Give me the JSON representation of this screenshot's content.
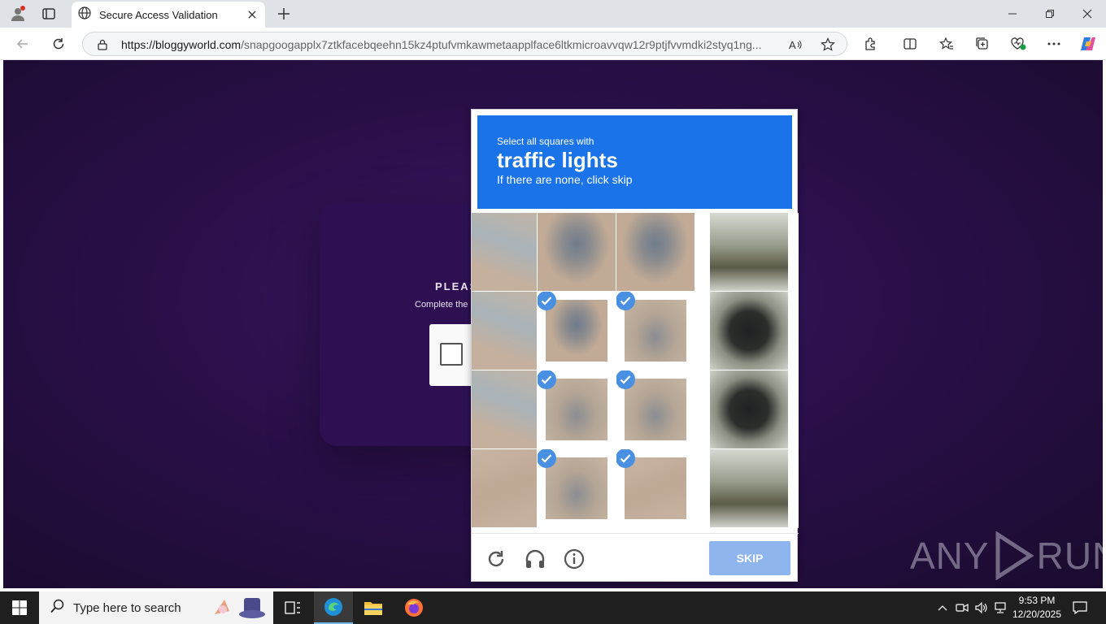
{
  "browser": {
    "tab_title": "Secure Access Validation",
    "url_host": "https://bloggyworld.com",
    "url_path": "/snapgoogapplx7ztkfacebqeehn15kz4ptufvmkawmetaapplface6ltkmicroavvqw12r9ptjfvvmdki2styq1ng..."
  },
  "page": {
    "heading": "PLEAS",
    "subtext": "Complete the"
  },
  "captcha": {
    "line1": "Select all squares with",
    "target": "traffic lights",
    "line3": "If there are none, click skip",
    "skip_label": "SKIP",
    "tiles": [
      {
        "row": 0,
        "col": 0,
        "type": "sand-water",
        "selected": false
      },
      {
        "row": 0,
        "col": 1,
        "type": "person",
        "selected": false
      },
      {
        "row": 0,
        "col": 2,
        "type": "person",
        "selected": false
      },
      {
        "row": 0,
        "col": 3,
        "type": "tree",
        "selected": false
      },
      {
        "row": 1,
        "col": 0,
        "type": "sand-water",
        "selected": false
      },
      {
        "row": 1,
        "col": 1,
        "type": "person",
        "selected": true
      },
      {
        "row": 1,
        "col": 2,
        "type": "bike",
        "selected": true
      },
      {
        "row": 1,
        "col": 3,
        "type": "tl",
        "selected": false
      },
      {
        "row": 2,
        "col": 0,
        "type": "sand-water",
        "selected": false
      },
      {
        "row": 2,
        "col": 1,
        "type": "bike",
        "selected": true
      },
      {
        "row": 2,
        "col": 2,
        "type": "bike",
        "selected": true
      },
      {
        "row": 2,
        "col": 3,
        "type": "tl",
        "selected": false
      },
      {
        "row": 3,
        "col": 0,
        "type": "sand",
        "selected": false
      },
      {
        "row": 3,
        "col": 1,
        "type": "bike",
        "selected": true
      },
      {
        "row": 3,
        "col": 2,
        "type": "sand",
        "selected": true
      },
      {
        "row": 3,
        "col": 3,
        "type": "tree",
        "selected": false
      }
    ]
  },
  "watermark": {
    "left": "ANY",
    "right": "RUN"
  },
  "taskbar": {
    "search_placeholder": "Type here to search",
    "time": "9:53 PM",
    "date": "12/20/2025"
  }
}
